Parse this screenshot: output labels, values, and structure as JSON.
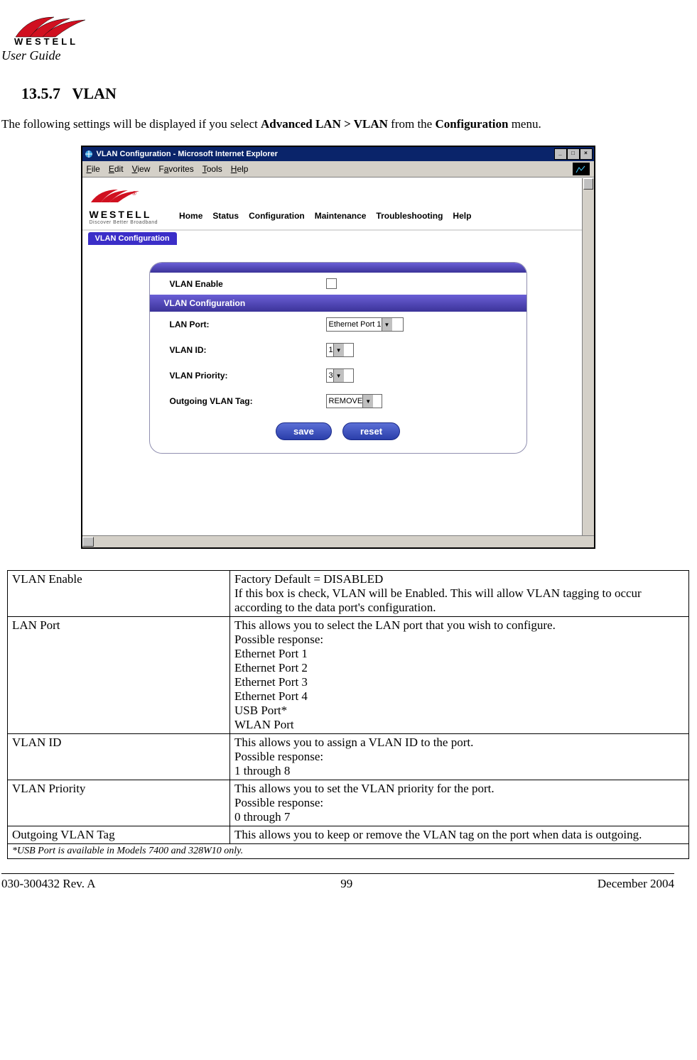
{
  "header": {
    "brand": "WESTELL",
    "guide_label": "User Guide"
  },
  "section": {
    "number": "13.5.7",
    "title": "VLAN",
    "intro_prefix": "The following settings will be displayed if you select ",
    "intro_bold1": "Advanced LAN > VLAN",
    "intro_mid": " from the ",
    "intro_bold2": "Configuration",
    "intro_suffix": " menu."
  },
  "browser": {
    "title": "VLAN Configuration - Microsoft Internet Explorer",
    "menus": {
      "file": "File",
      "edit": "Edit",
      "view": "View",
      "favorites": "Favorites",
      "tools": "Tools",
      "help": "Help"
    },
    "logo_brand": "WESTELL",
    "logo_tagline": "Discover Better Broadband",
    "nav": {
      "home": "Home",
      "status": "Status",
      "config": "Configuration",
      "maint": "Maintenance",
      "trouble": "Troubleshooting",
      "help": "Help"
    },
    "subnav": "VLAN Configuration",
    "fields": {
      "vlan_enable": "VLAN Enable",
      "section_header": "VLAN Configuration",
      "lan_port": "LAN Port:",
      "lan_port_value": "Ethernet Port 1",
      "vlan_id": "VLAN ID:",
      "vlan_id_value": "1",
      "vlan_priority": "VLAN Priority:",
      "vlan_priority_value": "3",
      "out_tag": "Outgoing VLAN Tag:",
      "out_tag_value": "REMOVE",
      "save": "save",
      "reset": "reset"
    }
  },
  "params": [
    {
      "name": "VLAN Enable",
      "desc": "Factory Default = DISABLED\nIf this box is check, VLAN will be Enabled. This will allow VLAN tagging to occur according to the data port's configuration."
    },
    {
      "name": "LAN Port",
      "desc": "This allows you to select the LAN port that you wish to configure.\nPossible response:\nEthernet Port 1\nEthernet Port 2\nEthernet Port 3\nEthernet Port 4\nUSB Port*\nWLAN Port"
    },
    {
      "name": "VLAN ID",
      "desc": "This allows you to assign a VLAN ID to the port.\nPossible response:\n1 through 8"
    },
    {
      "name": "VLAN Priority",
      "desc": "This allows you to set the VLAN priority for the port.\nPossible response:\n0 through 7"
    },
    {
      "name": "Outgoing VLAN Tag",
      "desc": "This allows you to keep or remove the VLAN tag on the port when data is outgoing."
    }
  ],
  "footnote": "*USB Port is available in Models 7400 and 328W10 only.",
  "footer": {
    "left": "030-300432 Rev. A",
    "center": "99",
    "right": "December 2004"
  }
}
